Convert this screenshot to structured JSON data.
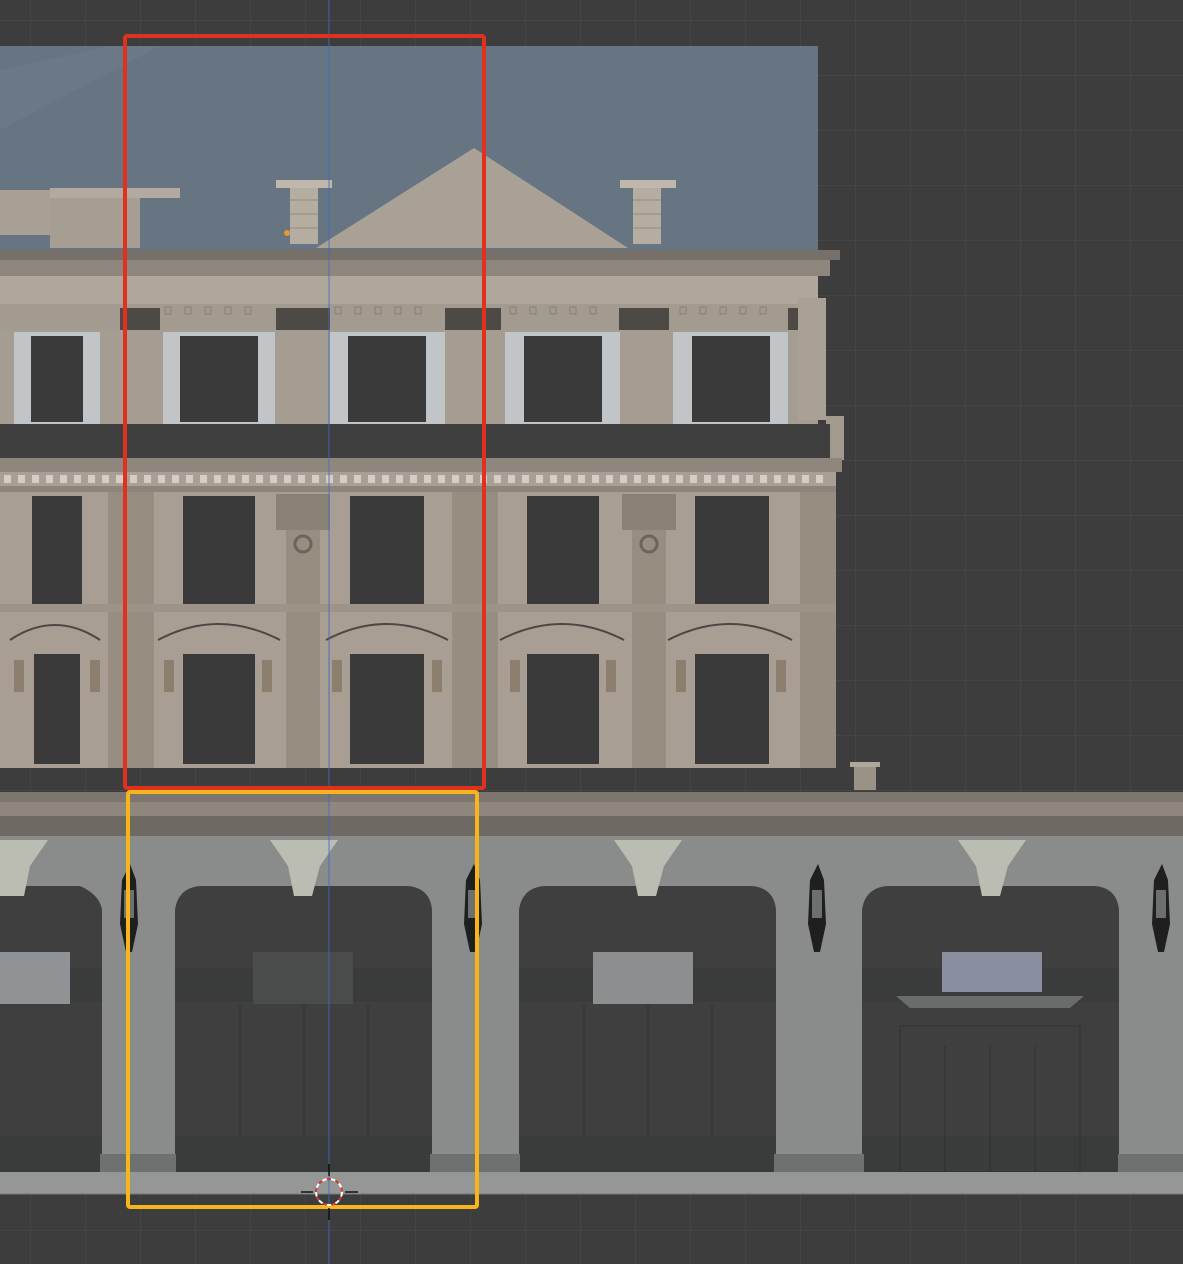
{
  "viewport": {
    "background": "#3d3d3d",
    "grid_color": "#454545",
    "cursor_icon": "3d-cursor-icon"
  },
  "colors": {
    "roof_blue": "#677583",
    "stone": "#a89e93",
    "stone_dark": "#8f857a",
    "window": "#3a3a3a",
    "arcade": "#8a8b8b",
    "shop_dark": "#3f3f40",
    "selection_red": "#e0301e",
    "selection_yellow": "#f5b51b"
  },
  "selection": {
    "upper_box": "red",
    "lower_box": "yellow"
  }
}
